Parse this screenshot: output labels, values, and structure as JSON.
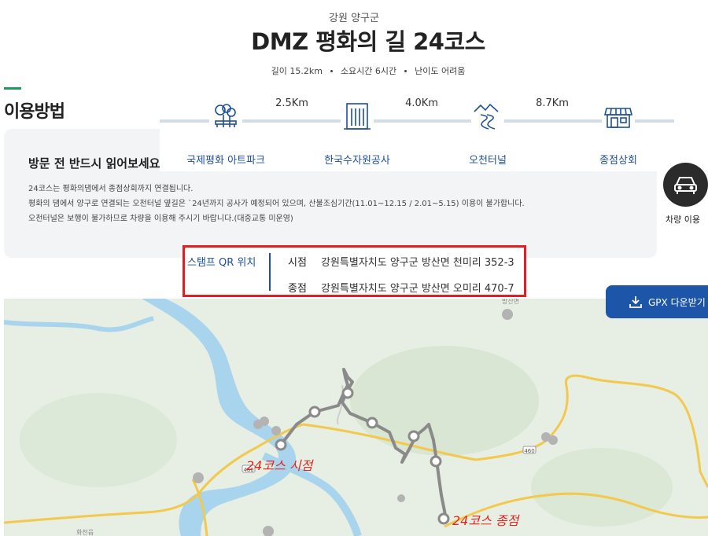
{
  "header": {
    "region": "강원 양구군",
    "title": "DMZ 평화의 길 24코스",
    "meta": {
      "length": "길이 15.2km",
      "time": "소요시간 6시간",
      "difficulty": "난이도 어려움"
    }
  },
  "usage": {
    "title": "이용방법",
    "heading": "방문 전 반드시 읽어보세요!",
    "lines": [
      "24코스는 평화의댐에서 종점상회까지 연결됩니다.",
      "평화의 댐에서 양구로 연결되는 오천터널 옆길은 `24년까지 공사가 예정되어 있으며, 산불조심기간(11.01~12.15 / 2.01~5.15) 이용이 불가합니다.",
      "오천터널은 보행이 불가하므로 차량을 이용해 주시기 바랍니다.(대중교통 미운영)"
    ]
  },
  "course": {
    "stops": [
      {
        "label": "국제평화 아트파크",
        "icon": "tree-bench-icon"
      },
      {
        "label": "한국수자원공사",
        "icon": "office-building-icon"
      },
      {
        "label": "오천터널",
        "icon": "tunnel-road-icon"
      },
      {
        "label": "종점상회",
        "icon": "store-icon"
      }
    ],
    "distances": [
      "2.5Km",
      "4.0Km",
      "8.7Km"
    ]
  },
  "vehicle": {
    "label": "차량 이용",
    "icon": "car-icon"
  },
  "stamp": {
    "title": "스탬프 QR 위치",
    "start_key": "시점",
    "start_value": "강원특별자치도 양구군 방산면 천미리 352-3",
    "end_key": "종점",
    "end_value": "강원특별자치도 양구군 방산면 오미리 470-7"
  },
  "gpx": {
    "label": "GPX 다운받기",
    "icon": "download-icon"
  },
  "map": {
    "start_annotation": "24코스 시점",
    "end_annotation": "24코스 종점",
    "road_number": "460",
    "place_top": "방산면",
    "place_bottom": "화천읍",
    "colors": {
      "land": "#e7eee3",
      "water": "#a9d4ee",
      "road": "#f2c94c",
      "route": "#8a8a8a",
      "annotation": "#e0251b"
    }
  },
  "colors": {
    "accent": "#1d4f9c",
    "green": "#1a9c5a",
    "highlight": "#e01e26"
  }
}
